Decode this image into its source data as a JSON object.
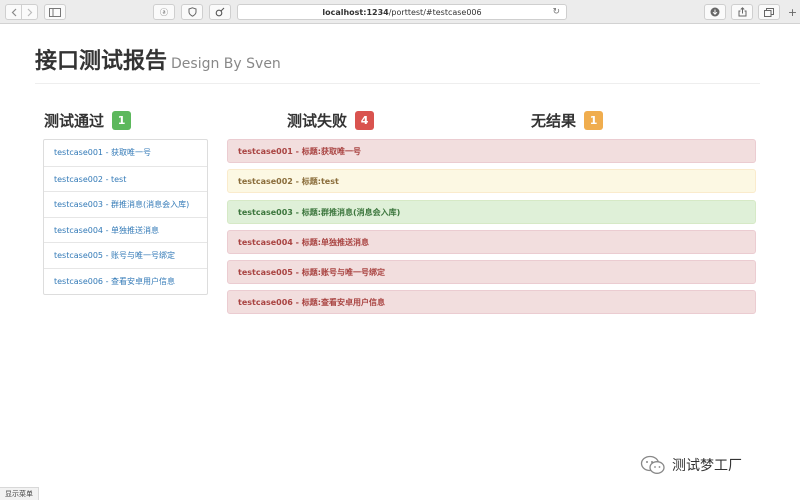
{
  "browser": {
    "back_icon": "chevron-left-icon",
    "forward_icon": "chevron-right-icon",
    "ext1_label": "ⓐ",
    "url_host": "localhost:1234",
    "url_path": "/porttest/#testcase006"
  },
  "header": {
    "title": "接口测试报告",
    "subtitle": "Design By Sven"
  },
  "columns": {
    "passed": {
      "label": "测试通过",
      "count": "1",
      "color": "#5cb85c"
    },
    "failed": {
      "label": "测试失败",
      "count": "4",
      "color": "#d9534f"
    },
    "noresult": {
      "label": "无结果",
      "count": "1",
      "color": "#f0ad4e"
    }
  },
  "passed_items": [
    "testcase001 - 获取唯一号",
    "testcase002 - test",
    "testcase003 - 群推消息(消息会入库)",
    "testcase004 - 单独推送消息",
    "testcase005 - 账号与唯一号绑定",
    "testcase006 - 查看安卓用户信息"
  ],
  "results": [
    {
      "text": "testcase001 - 标题:获取唯一号",
      "status": "danger"
    },
    {
      "text": "testcase002 - 标题:test",
      "status": "warning"
    },
    {
      "text": "testcase003 - 标题:群推消息(消息会入库)",
      "status": "success"
    },
    {
      "text": "testcase004 - 标题:单独推送消息",
      "status": "danger"
    },
    {
      "text": "testcase005 - 标题:账号与唯一号绑定",
      "status": "danger"
    },
    {
      "text": "testcase006 - 标题:查看安卓用户信息",
      "status": "danger"
    }
  ],
  "status_colors": {
    "danger": {
      "bg": "#f2dede",
      "fg": "#a94442",
      "border": "#ebccd1"
    },
    "warning": {
      "bg": "#fcf8e3",
      "fg": "#8a6d3b",
      "border": "#faebcc"
    },
    "success": {
      "bg": "#dff0d8",
      "fg": "#3c763d",
      "border": "#d6e9c6"
    }
  },
  "watermark": {
    "text": "测试梦工厂",
    "icon": "wechat-icon"
  },
  "statusbar": {
    "text": "显示菜单"
  }
}
